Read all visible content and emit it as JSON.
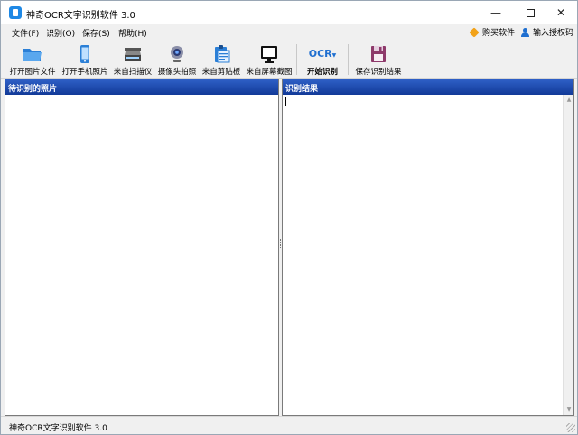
{
  "window": {
    "title": "神奇OCR文字识别软件 3.0"
  },
  "window_controls": {
    "minimize": "—",
    "close": "✕"
  },
  "menu": {
    "items": [
      {
        "label": "文件(F)"
      },
      {
        "label": "识别(O)"
      },
      {
        "label": "保存(S)"
      },
      {
        "label": "帮助(H)"
      }
    ],
    "buy": "购买软件",
    "register": "输入授权码"
  },
  "toolbar": {
    "buttons": [
      {
        "label": "打开图片文件",
        "icon": "folder-icon"
      },
      {
        "label": "打开手机照片",
        "icon": "phone-icon"
      },
      {
        "label": "来自扫描仪",
        "icon": "scanner-icon"
      },
      {
        "label": "摄像头拍照",
        "icon": "webcam-icon"
      },
      {
        "label": "来自剪贴板",
        "icon": "clipboard-icon"
      },
      {
        "label": "来自屏幕截图",
        "icon": "monitor-icon"
      },
      {
        "label": "开始识别",
        "icon": "ocr-icon",
        "icon_text": "OCR"
      },
      {
        "label": "保存识别结果",
        "icon": "floppy-icon"
      }
    ]
  },
  "panels": {
    "left_title": "待识别的照片",
    "right_title": "识别结果"
  },
  "status": {
    "text": "神奇OCR文字识别软件 3.0"
  },
  "colors": {
    "header_blue": "#1f4ab0",
    "accent_orange": "#f2a218",
    "icon_blue": "#1f6fd0"
  }
}
